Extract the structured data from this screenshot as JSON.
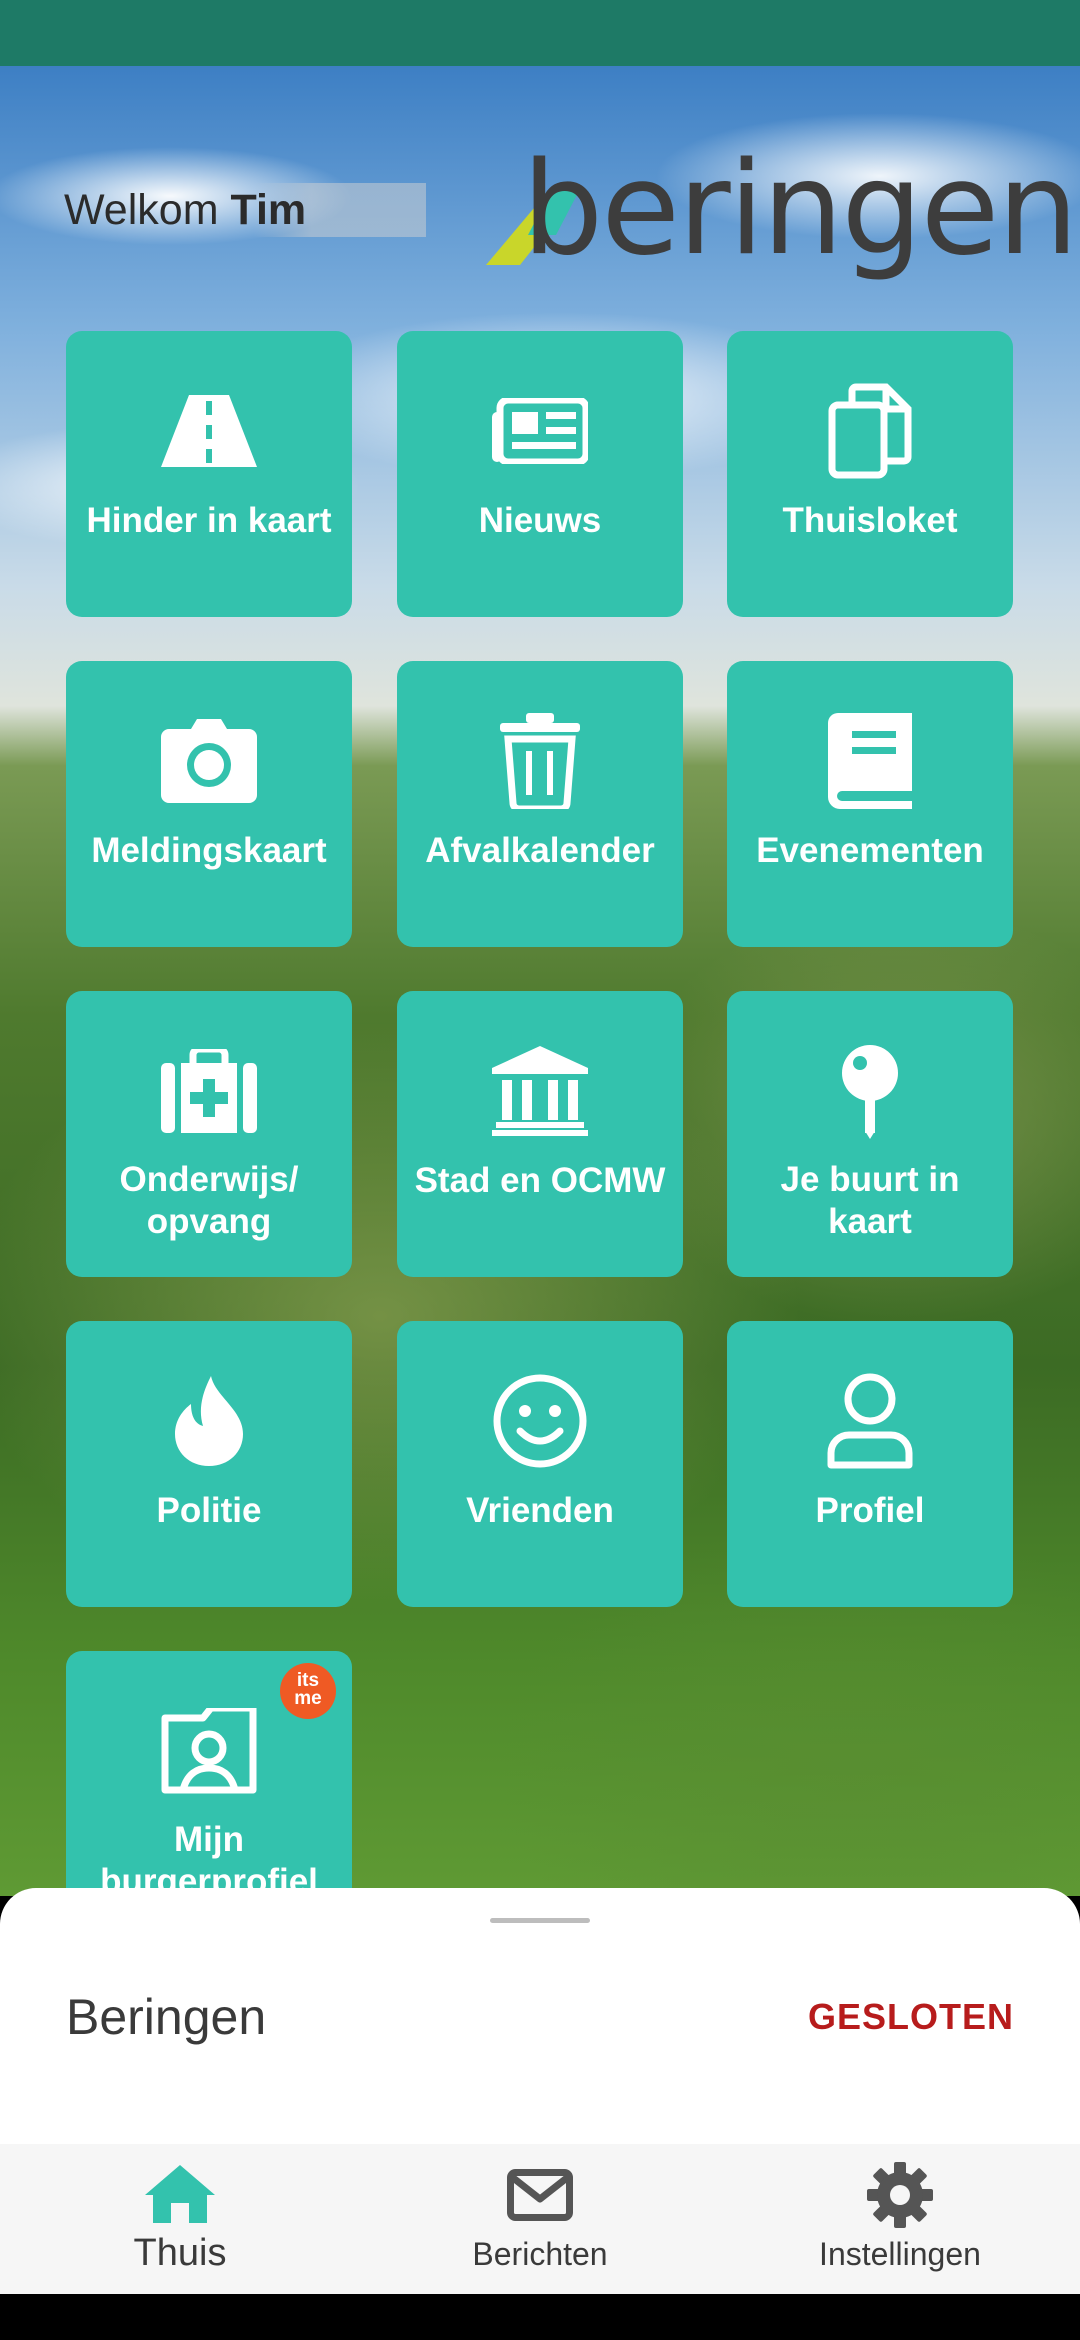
{
  "header": {
    "welcome_prefix": "Welkom ",
    "user_name": "Tim",
    "logo_text": "beringen"
  },
  "tiles": [
    {
      "label": "Hinder in kaart",
      "icon": "road-icon"
    },
    {
      "label": "Nieuws",
      "icon": "newspaper-icon"
    },
    {
      "label": "Thuisloket",
      "icon": "copy-documents-icon"
    },
    {
      "label": "Meldingskaart",
      "icon": "camera-icon"
    },
    {
      "label": "Afvalkalender",
      "icon": "trash-icon"
    },
    {
      "label": "Evenementen",
      "icon": "book-icon"
    },
    {
      "label": "Onderwijs/ opvang",
      "icon": "first-aid-kit-icon"
    },
    {
      "label": "Stad en OCMW",
      "icon": "town-hall-icon"
    },
    {
      "label": "Je buurt in kaart",
      "icon": "map-pin-icon"
    },
    {
      "label": "Politie",
      "icon": "flame-icon"
    },
    {
      "label": "Vrienden",
      "icon": "smiley-icon"
    },
    {
      "label": "Profiel",
      "icon": "user-icon"
    },
    {
      "label": "Mijn burgerprofiel",
      "icon": "id-card-folder-icon"
    }
  ],
  "badge": {
    "text_line1": "its",
    "text_line2": "me"
  },
  "sheet": {
    "title": "Beringen",
    "status": "GESLOTEN",
    "status_color": "#b71c1c"
  },
  "nav": {
    "items": [
      {
        "label": "Thuis",
        "icon": "home-icon",
        "active": true
      },
      {
        "label": "Berichten",
        "icon": "mail-icon",
        "active": false
      },
      {
        "label": "Instellingen",
        "icon": "gear-icon",
        "active": false
      }
    ]
  },
  "colors": {
    "accent": "#33c2ad",
    "statusbar": "#1e7a66",
    "nav_active": "#33c2ad",
    "nav_inactive": "#555555"
  }
}
